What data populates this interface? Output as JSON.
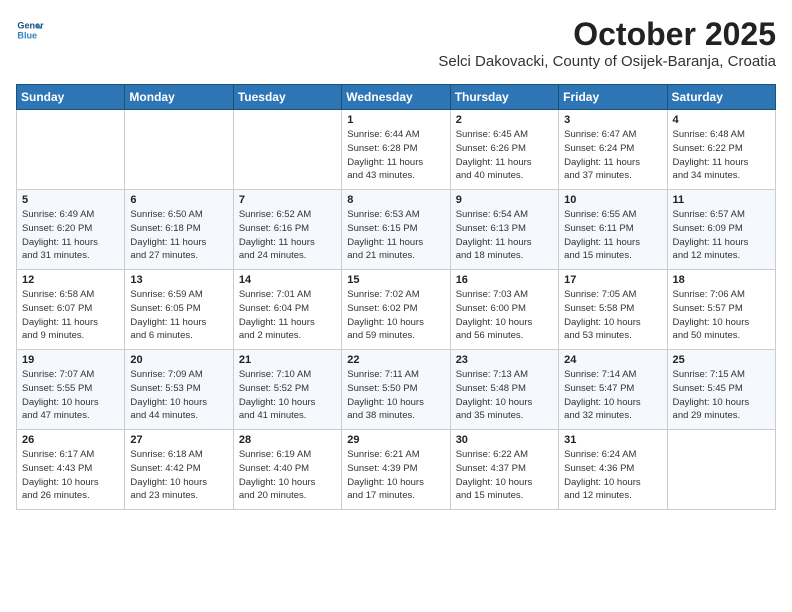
{
  "header": {
    "logo_line1": "General",
    "logo_line2": "Blue",
    "month_title": "October 2025",
    "subtitle": "Selci Dakovacki, County of Osijek-Baranja, Croatia"
  },
  "weekdays": [
    "Sunday",
    "Monday",
    "Tuesday",
    "Wednesday",
    "Thursday",
    "Friday",
    "Saturday"
  ],
  "weeks": [
    [
      {
        "day": "",
        "info": ""
      },
      {
        "day": "",
        "info": ""
      },
      {
        "day": "",
        "info": ""
      },
      {
        "day": "1",
        "info": "Sunrise: 6:44 AM\nSunset: 6:28 PM\nDaylight: 11 hours\nand 43 minutes."
      },
      {
        "day": "2",
        "info": "Sunrise: 6:45 AM\nSunset: 6:26 PM\nDaylight: 11 hours\nand 40 minutes."
      },
      {
        "day": "3",
        "info": "Sunrise: 6:47 AM\nSunset: 6:24 PM\nDaylight: 11 hours\nand 37 minutes."
      },
      {
        "day": "4",
        "info": "Sunrise: 6:48 AM\nSunset: 6:22 PM\nDaylight: 11 hours\nand 34 minutes."
      }
    ],
    [
      {
        "day": "5",
        "info": "Sunrise: 6:49 AM\nSunset: 6:20 PM\nDaylight: 11 hours\nand 31 minutes."
      },
      {
        "day": "6",
        "info": "Sunrise: 6:50 AM\nSunset: 6:18 PM\nDaylight: 11 hours\nand 27 minutes."
      },
      {
        "day": "7",
        "info": "Sunrise: 6:52 AM\nSunset: 6:16 PM\nDaylight: 11 hours\nand 24 minutes."
      },
      {
        "day": "8",
        "info": "Sunrise: 6:53 AM\nSunset: 6:15 PM\nDaylight: 11 hours\nand 21 minutes."
      },
      {
        "day": "9",
        "info": "Sunrise: 6:54 AM\nSunset: 6:13 PM\nDaylight: 11 hours\nand 18 minutes."
      },
      {
        "day": "10",
        "info": "Sunrise: 6:55 AM\nSunset: 6:11 PM\nDaylight: 11 hours\nand 15 minutes."
      },
      {
        "day": "11",
        "info": "Sunrise: 6:57 AM\nSunset: 6:09 PM\nDaylight: 11 hours\nand 12 minutes."
      }
    ],
    [
      {
        "day": "12",
        "info": "Sunrise: 6:58 AM\nSunset: 6:07 PM\nDaylight: 11 hours\nand 9 minutes."
      },
      {
        "day": "13",
        "info": "Sunrise: 6:59 AM\nSunset: 6:05 PM\nDaylight: 11 hours\nand 6 minutes."
      },
      {
        "day": "14",
        "info": "Sunrise: 7:01 AM\nSunset: 6:04 PM\nDaylight: 11 hours\nand 2 minutes."
      },
      {
        "day": "15",
        "info": "Sunrise: 7:02 AM\nSunset: 6:02 PM\nDaylight: 10 hours\nand 59 minutes."
      },
      {
        "day": "16",
        "info": "Sunrise: 7:03 AM\nSunset: 6:00 PM\nDaylight: 10 hours\nand 56 minutes."
      },
      {
        "day": "17",
        "info": "Sunrise: 7:05 AM\nSunset: 5:58 PM\nDaylight: 10 hours\nand 53 minutes."
      },
      {
        "day": "18",
        "info": "Sunrise: 7:06 AM\nSunset: 5:57 PM\nDaylight: 10 hours\nand 50 minutes."
      }
    ],
    [
      {
        "day": "19",
        "info": "Sunrise: 7:07 AM\nSunset: 5:55 PM\nDaylight: 10 hours\nand 47 minutes."
      },
      {
        "day": "20",
        "info": "Sunrise: 7:09 AM\nSunset: 5:53 PM\nDaylight: 10 hours\nand 44 minutes."
      },
      {
        "day": "21",
        "info": "Sunrise: 7:10 AM\nSunset: 5:52 PM\nDaylight: 10 hours\nand 41 minutes."
      },
      {
        "day": "22",
        "info": "Sunrise: 7:11 AM\nSunset: 5:50 PM\nDaylight: 10 hours\nand 38 minutes."
      },
      {
        "day": "23",
        "info": "Sunrise: 7:13 AM\nSunset: 5:48 PM\nDaylight: 10 hours\nand 35 minutes."
      },
      {
        "day": "24",
        "info": "Sunrise: 7:14 AM\nSunset: 5:47 PM\nDaylight: 10 hours\nand 32 minutes."
      },
      {
        "day": "25",
        "info": "Sunrise: 7:15 AM\nSunset: 5:45 PM\nDaylight: 10 hours\nand 29 minutes."
      }
    ],
    [
      {
        "day": "26",
        "info": "Sunrise: 6:17 AM\nSunset: 4:43 PM\nDaylight: 10 hours\nand 26 minutes."
      },
      {
        "day": "27",
        "info": "Sunrise: 6:18 AM\nSunset: 4:42 PM\nDaylight: 10 hours\nand 23 minutes."
      },
      {
        "day": "28",
        "info": "Sunrise: 6:19 AM\nSunset: 4:40 PM\nDaylight: 10 hours\nand 20 minutes."
      },
      {
        "day": "29",
        "info": "Sunrise: 6:21 AM\nSunset: 4:39 PM\nDaylight: 10 hours\nand 17 minutes."
      },
      {
        "day": "30",
        "info": "Sunrise: 6:22 AM\nSunset: 4:37 PM\nDaylight: 10 hours\nand 15 minutes."
      },
      {
        "day": "31",
        "info": "Sunrise: 6:24 AM\nSunset: 4:36 PM\nDaylight: 10 hours\nand 12 minutes."
      },
      {
        "day": "",
        "info": ""
      }
    ]
  ]
}
